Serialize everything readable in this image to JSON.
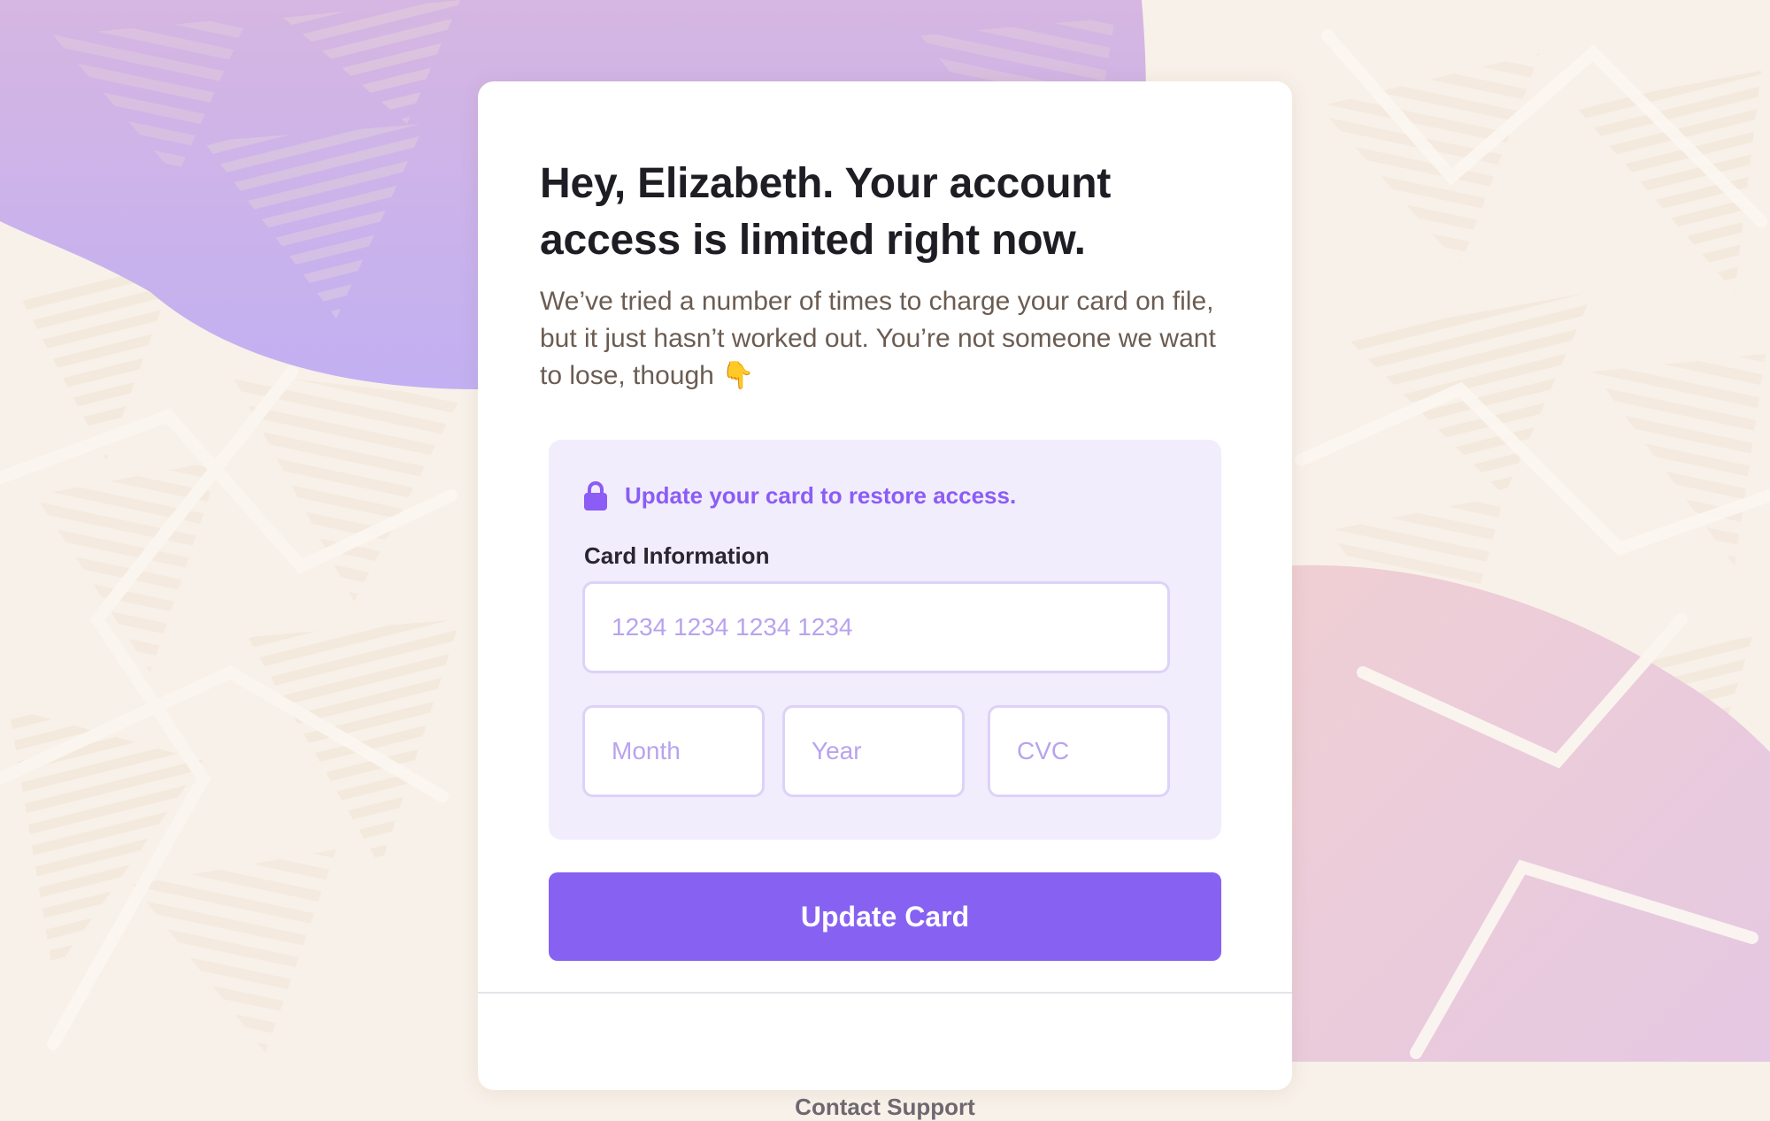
{
  "background": {
    "base_color": "#f8f1e9",
    "blob_top_color": "#c9b0e8",
    "blob_bottom_color": "#e9c9d3"
  },
  "card": {
    "headline": "Hey, Elizabeth. Your account access is limited right now.",
    "intro": "We’ve tried a number of times to charge your card on file, but it just hasn’t worked out. You’re not someone we want to lose, though 👇",
    "notice": {
      "icon": "lock-icon",
      "text": "Update your card to restore access."
    },
    "card_information_label": "Card Information",
    "fields": {
      "card_number_placeholder": "1234 1234 1234 1234",
      "month_placeholder": "Month",
      "year_placeholder": "Year",
      "cvc_placeholder": "CVC"
    },
    "submit_label": "Update Card",
    "support_label": "Contact Support"
  },
  "colors": {
    "accent": "#8b5cf6",
    "button": "#8762f2",
    "panel": "#f1edfc",
    "placeholder": "#b9a3ee"
  }
}
